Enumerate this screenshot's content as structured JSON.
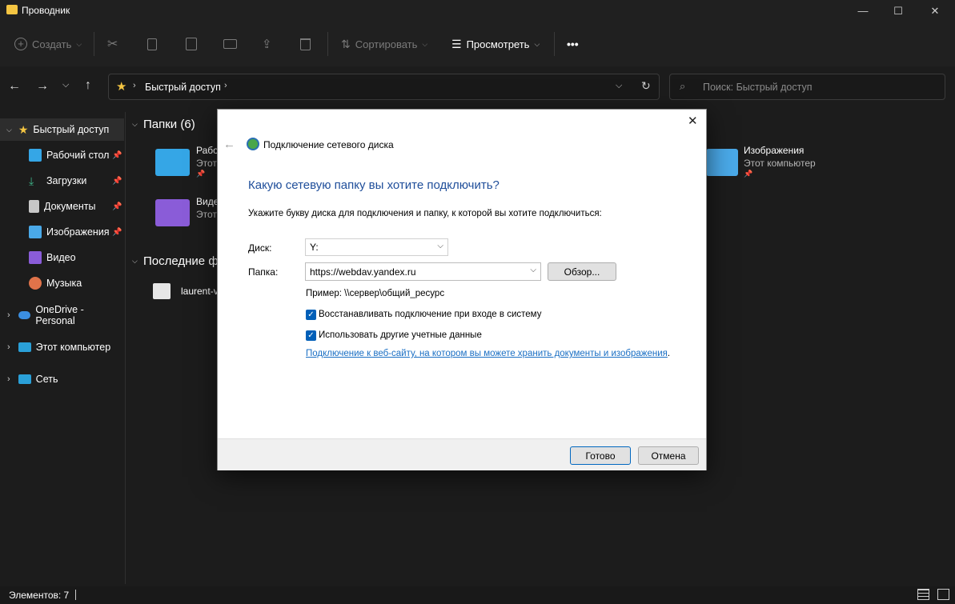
{
  "window": {
    "title": "Проводник"
  },
  "toolbar": {
    "new_label": "Создать",
    "sort_label": "Сортировать",
    "view_label": "Просмотреть",
    "more_label": "•••"
  },
  "address": {
    "crumb": "Быстрый доступ",
    "search_placeholder": "Поиск: Быстрый доступ"
  },
  "sidebar": {
    "items": [
      {
        "label": "Быстрый доступ",
        "icon": "star-icon"
      },
      {
        "label": "Рабочий стол",
        "icon": "desktop-icon"
      },
      {
        "label": "Загрузки",
        "icon": "download-icon"
      },
      {
        "label": "Документы",
        "icon": "documents-icon"
      },
      {
        "label": "Изображения",
        "icon": "pictures-icon"
      },
      {
        "label": "Видео",
        "icon": "video-icon"
      },
      {
        "label": "Музыка",
        "icon": "music-icon"
      },
      {
        "label": "OneDrive - Personal",
        "icon": "cloud-icon"
      },
      {
        "label": "Этот компьютер",
        "icon": "computer-icon"
      },
      {
        "label": "Сеть",
        "icon": "network-icon"
      }
    ]
  },
  "main": {
    "folders_header": "Папки (6)",
    "folders": [
      {
        "name": "Рабо",
        "location": "Этот"
      },
      {
        "name": "Виде",
        "location": "Этот"
      },
      {
        "name": "Изображения",
        "location": "Этот компьютер"
      }
    ],
    "recent_header": "Последние ф",
    "recent_items": [
      {
        "name": "laurent-v"
      }
    ]
  },
  "status": {
    "count": "Элементов: 7"
  },
  "dialog": {
    "title": "Подключение сетевого диска",
    "heading": "Какую сетевую папку вы хотите подключить?",
    "instructions": "Укажите букву диска для подключения и папку, к которой вы хотите подключиться:",
    "drive_label": "Диск:",
    "drive_value": "Y:",
    "folder_label": "Папка:",
    "folder_value": "https://webdav.yandex.ru",
    "browse_label": "Обзор...",
    "example": "Пример: \\\\сервер\\общий_ресурс",
    "reconnect_label": "Восстанавливать подключение при входе в систему",
    "reconnect_checked": true,
    "credentials_label": "Использовать другие учетные данные",
    "credentials_checked": true,
    "link": "Подключение к веб-сайту, на котором вы можете хранить документы и изображения",
    "ok_label": "Готово",
    "cancel_label": "Отмена"
  }
}
